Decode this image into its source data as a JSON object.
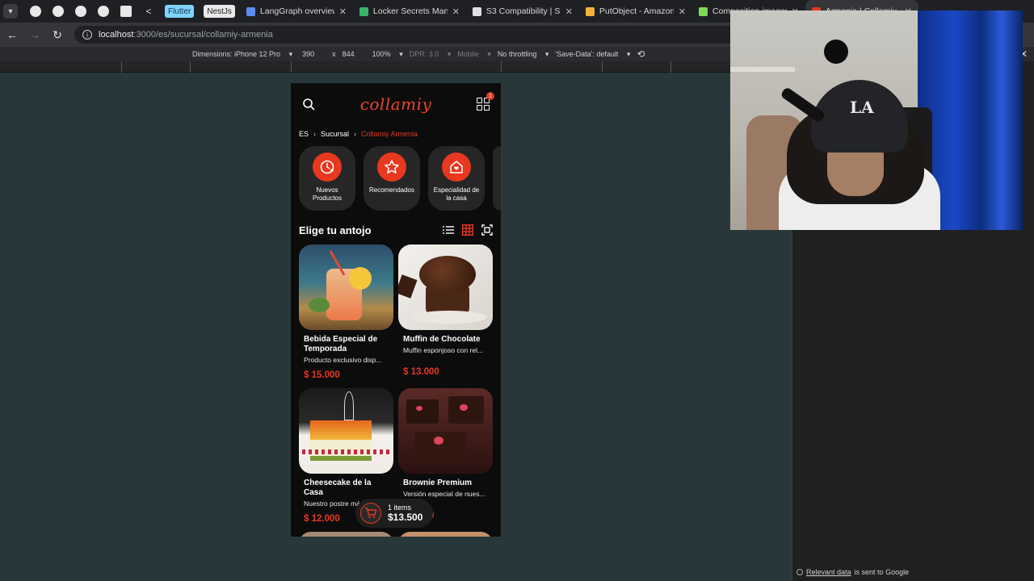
{
  "browser": {
    "tabs": [
      {
        "label": "LangGraph overview - Do",
        "color": "#5b8def"
      },
      {
        "label": "Locker Secrets Manager -",
        "color": "#3bb36b"
      },
      {
        "label": "S3 Compatibility | Supaba",
        "color": "#e0e0e0"
      },
      {
        "label": "PutObject - Amazon Simp",
        "color": "#f0b43a"
      },
      {
        "label": "Composition images Lab",
        "color": "#7ed957"
      },
      {
        "label": "Armenia | Collamiy",
        "color": "#e03a23"
      }
    ],
    "flutter_badge": "Flutter",
    "nest_badge": "NestJs",
    "url_host": "localhost",
    "url_path": ":3000/es/sucursal/collamiy-armenia"
  },
  "devtools": {
    "dimensions": "Dimensions: iPhone 12 Pro",
    "width": "390",
    "times": "x",
    "height": "844",
    "zoom": "100%",
    "dpr": "DPR: 3.0",
    "mobile": "Mobile",
    "throttle": "No throttling",
    "savedata": "'Save-Data': default",
    "footer_link": "Relevant data",
    "footer_text": "is sent to Google"
  },
  "app": {
    "logo": "collamiy",
    "cart_count": "1",
    "breadcrumb": [
      "ES",
      "Sucursal",
      "Collamiy Armenia"
    ],
    "categories": [
      {
        "label": "Nuevos Productos",
        "icon": "clock-plus-icon"
      },
      {
        "label": "Recomendados",
        "icon": "star-icon"
      },
      {
        "label": "Especialidad de la casa",
        "icon": "home-heart-icon"
      }
    ],
    "section_title": "Elige tu antojo",
    "products": [
      {
        "name": "Bebida Especial de Temporada",
        "desc": "Producto exclusivo disp...",
        "price": "$ 15.000"
      },
      {
        "name": "Muffin de Chocolate",
        "desc": "Muffin esponjoso con rel...",
        "price": "$ 13.000"
      },
      {
        "name": "Cheesecake de la Casa",
        "desc": "Nuestro postre más...",
        "price": "$ 12.000"
      },
      {
        "name": "Brownie Premium",
        "desc": "Versión especial de nues...",
        "price": "$ 9.500"
      }
    ],
    "cart": {
      "items": "1 items",
      "total": "$13.500"
    }
  }
}
